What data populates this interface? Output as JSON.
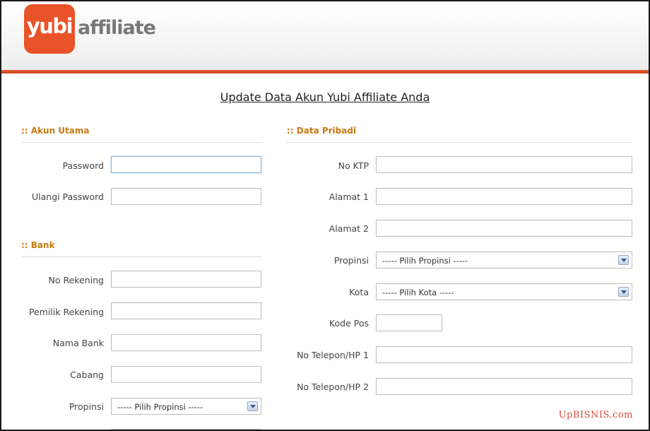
{
  "header": {
    "logo_badge": "yubi",
    "logo_affiliate": "affiliate"
  },
  "page_title": "Update Data Akun Yubi Affiliate Anda",
  "akun_utama": {
    "title": ":: Akun Utama",
    "password_label": "Password",
    "ulangi_password_label": "Ulangi Password"
  },
  "bank": {
    "title": ":: Bank",
    "no_rekening_label": "No Rekening",
    "pemilik_rekening_label": "Pemilik Rekening",
    "nama_bank_label": "Nama Bank",
    "cabang_label": "Cabang",
    "propinsi_label": "Propinsi",
    "propinsi_selected": "----- Pilih Propinsi -----"
  },
  "data_pribadi": {
    "title": ":: Data Pribadi",
    "no_ktp_label": "No KTP",
    "alamat1_label": "Alamat 1",
    "alamat2_label": "Alamat 2",
    "propinsi_label": "Propinsi",
    "propinsi_selected": "----- Pilih Propinsi -----",
    "kota_label": "Kota",
    "kota_selected": "----- Pilih Kota -----",
    "kode_pos_label": "Kode Pos",
    "no_telepon1_label": "No Telepon/HP 1",
    "no_telepon2_label": "No Telepon/HP 2"
  },
  "watermark": "UpBISNIS.com",
  "colors": {
    "brand_orange": "#e8532a",
    "section_title": "#c67a12",
    "watermark": "#d64a3a"
  }
}
